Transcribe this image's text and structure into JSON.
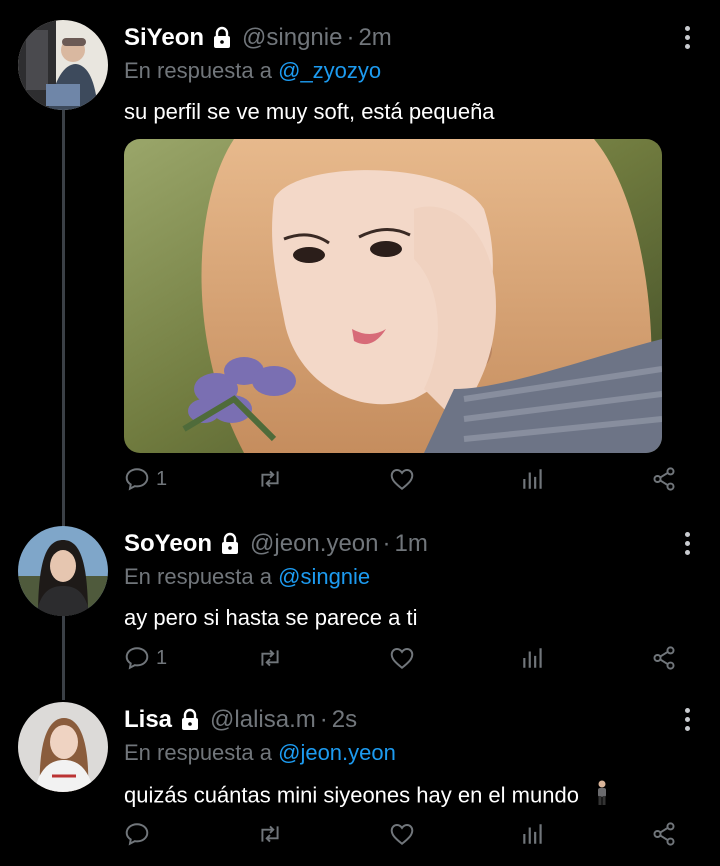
{
  "tweets": [
    {
      "name": "SiYeon",
      "handle": "@singnie",
      "time": "2m",
      "reply_prefix": "En respuesta a",
      "reply_to": "@_zyozyo",
      "text": "su perfil se ve muy soft, está pequeña",
      "reply_count": "1"
    },
    {
      "name": "SoYeon",
      "handle": "@jeon.yeon",
      "time": "1m",
      "reply_prefix": "En respuesta a",
      "reply_to": "@singnie",
      "text": "ay pero si hasta se parece a ti",
      "reply_count": "1"
    },
    {
      "name": "Lisa",
      "handle": "@lalisa.m",
      "time": "2s",
      "reply_prefix": "En respuesta a",
      "reply_to": "@jeon.yeon",
      "text": "quizás cuántas mini siyeones hay en el mundo",
      "reply_count": ""
    }
  ],
  "separator": "·",
  "icons": {
    "lock": "lock-icon",
    "more": "more-vertical-icon",
    "reply": "reply-icon",
    "retweet": "retweet-icon",
    "like": "heart-icon",
    "views": "views-icon",
    "share": "share-icon",
    "emoji": "standing-person-emoji"
  },
  "colors": {
    "background": "#000000",
    "text": "#e7e9ea",
    "muted": "#71767b",
    "link": "#1d9bf0",
    "thread_line": "#3b4046"
  }
}
